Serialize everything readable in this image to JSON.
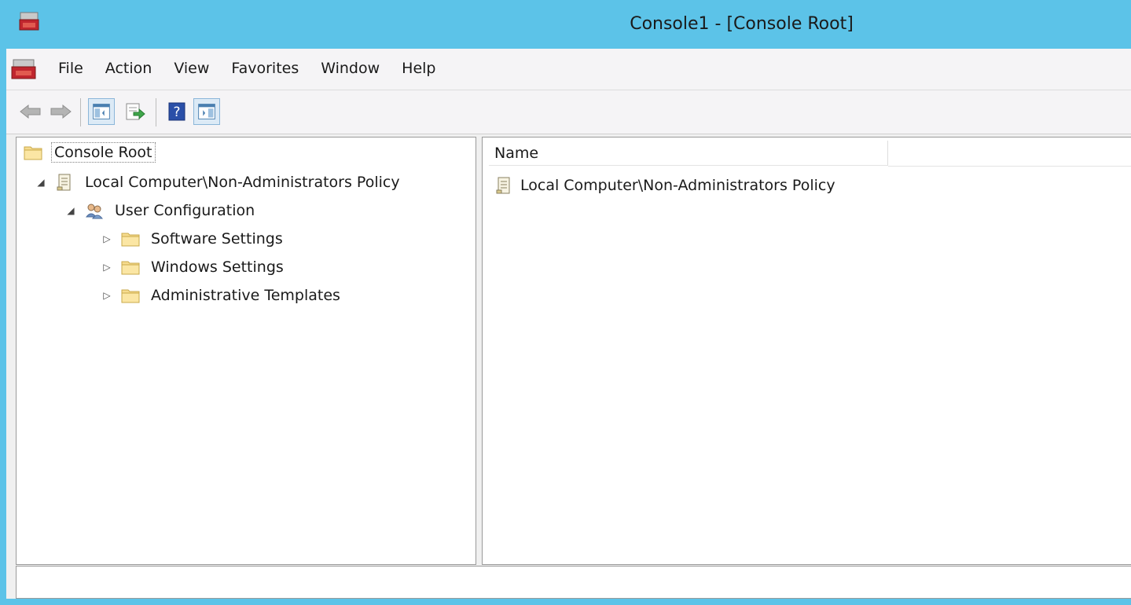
{
  "window": {
    "title": "Console1 - [Console Root]"
  },
  "menubar": {
    "items": [
      "File",
      "Action",
      "View",
      "Favorites",
      "Window",
      "Help"
    ]
  },
  "toolbar": {
    "buttons": [
      {
        "icon": "back-arrow-icon",
        "enabled": false
      },
      {
        "icon": "forward-arrow-icon",
        "enabled": false
      },
      {
        "icon": "show-hide-console-tree-icon",
        "pressed": true
      },
      {
        "icon": "export-list-icon"
      },
      {
        "icon": "help-icon"
      },
      {
        "icon": "show-hide-action-pane-icon",
        "pressed": true
      }
    ]
  },
  "tree": {
    "root": "Console Root",
    "policy": "Local Computer\\Non-Administrators Policy",
    "user_config": "User Configuration",
    "children": [
      "Software Settings",
      "Windows Settings",
      "Administrative Templates"
    ]
  },
  "list": {
    "column_name": "Name",
    "rows": [
      "Local Computer\\Non-Administrators Policy"
    ]
  },
  "status": {
    "text": ""
  },
  "colors": {
    "titlebar": "#5cc3e8",
    "folder": "#f6dc8f"
  }
}
